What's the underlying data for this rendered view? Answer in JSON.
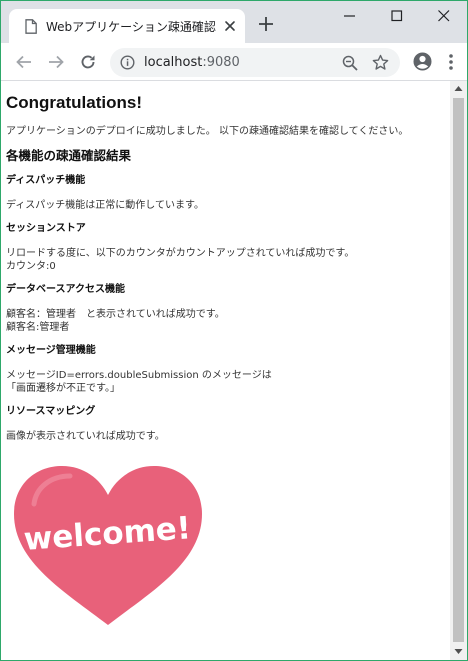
{
  "browser": {
    "tab_title": "Webアプリケーション疎通確認",
    "url_host": "localhost",
    "url_port": ":9080"
  },
  "page": {
    "heading": "Congratulations!",
    "intro": "アプリケーションのデプロイに成功しました。 以下の疎通確認結果を確認してください。",
    "results_heading": "各機能の疎通確認結果",
    "sections": [
      {
        "title": "ディスパッチ機能",
        "lines": [
          "ディスパッチ機能は正常に動作しています。"
        ]
      },
      {
        "title": "セッションストア",
        "lines": [
          "リロードする度に、以下のカウンタがカウントアップされていれば成功です。",
          "カウンタ:0"
        ]
      },
      {
        "title": "データベースアクセス機能",
        "lines": [
          "顧客名：管理者　と表示されていれば成功です。",
          "顧客名:管理者"
        ]
      },
      {
        "title": "メッセージ管理機能",
        "lines": [
          "メッセージID=errors.doubleSubmission のメッセージは",
          "「画面遷移が不正です。」"
        ]
      },
      {
        "title": "リソースマッピング",
        "lines": [
          "画像が表示されていれば成功です。"
        ]
      }
    ],
    "image_text": "welcome!"
  },
  "icons": {
    "tab": "document-icon",
    "close": "close-icon",
    "new_tab": "plus-icon",
    "back": "back-arrow-icon",
    "forward": "forward-arrow-icon",
    "reload": "reload-icon",
    "info": "info-icon",
    "zoom": "zoom-out-icon",
    "bookmark": "star-icon",
    "profile": "account-icon",
    "menu": "kebab-menu-icon"
  },
  "colors": {
    "heart": "#e8617a",
    "window_border": "#2ea86a",
    "tabstrip": "#dee1e6",
    "omnibox": "#f1f3f4"
  }
}
